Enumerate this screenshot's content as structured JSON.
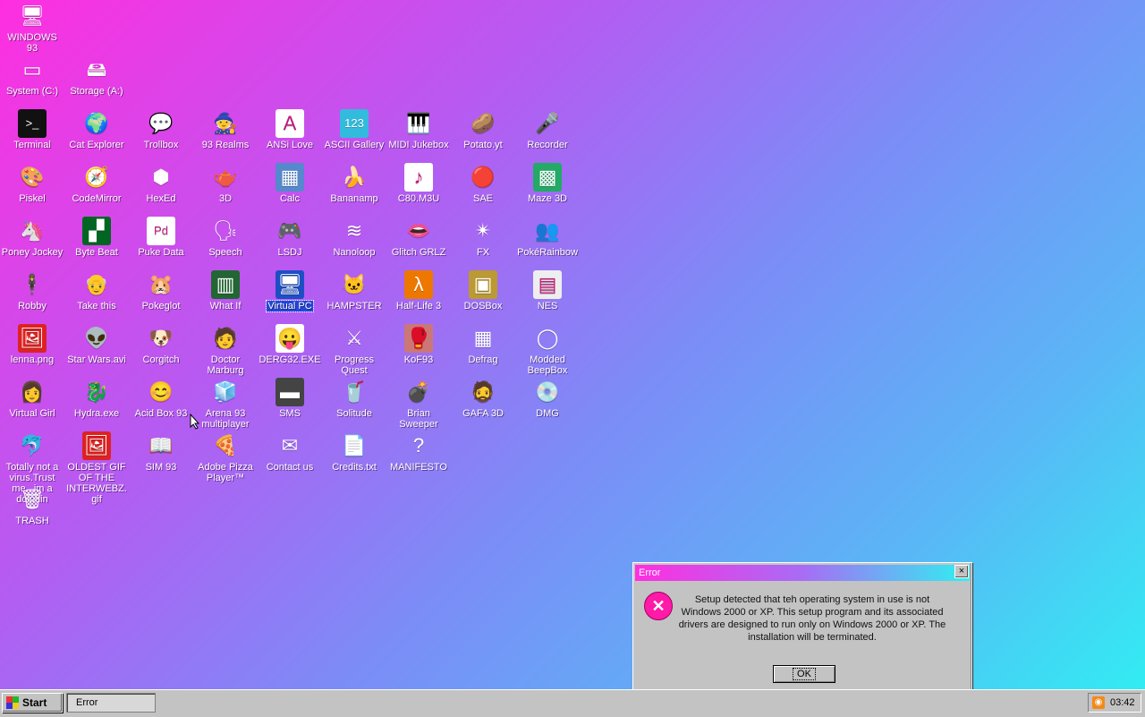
{
  "desktop": {
    "icons": [
      {
        "id": "windows93",
        "label": "WINDOWS 93",
        "glyph": "🖥",
        "bg": "transparent"
      },
      {
        "id": "system-c",
        "label": "System (C:)",
        "glyph": "▭",
        "bg": "transparent"
      },
      {
        "id": "storage-a",
        "label": "Storage (A:)",
        "glyph": "🖴",
        "bg": "transparent"
      },
      {
        "id": "terminal",
        "label": "Terminal",
        "glyph": ">_",
        "bg": "#111"
      },
      {
        "id": "cat-explorer",
        "label": "Cat Explorer",
        "glyph": "🌍",
        "bg": "transparent"
      },
      {
        "id": "trollbox",
        "label": "Trollbox",
        "glyph": "💬",
        "bg": "transparent"
      },
      {
        "id": "93-realms",
        "label": "93 Realms",
        "glyph": "🧙",
        "bg": "transparent"
      },
      {
        "id": "ansi-love",
        "label": "ANSi Love",
        "glyph": "A",
        "bg": "#fff"
      },
      {
        "id": "ascii-gallery",
        "label": "ASCII Gallery",
        "glyph": "123",
        "bg": "#3bd"
      },
      {
        "id": "midi-jukebox",
        "label": "MIDI Jukebox",
        "glyph": "🎹",
        "bg": "transparent"
      },
      {
        "id": "potato-yt",
        "label": "Potato.yt",
        "glyph": "🥔",
        "bg": "transparent"
      },
      {
        "id": "recorder",
        "label": "Recorder",
        "glyph": "🎤",
        "bg": "transparent"
      },
      {
        "id": "piskel",
        "label": "Piskel",
        "glyph": "🎨",
        "bg": "transparent"
      },
      {
        "id": "codemirror",
        "label": "CodeMirror",
        "glyph": "🧭",
        "bg": "transparent"
      },
      {
        "id": "hexed",
        "label": "HexEd",
        "glyph": "⬢",
        "bg": "transparent"
      },
      {
        "id": "3d",
        "label": "3D",
        "glyph": "🫖",
        "bg": "transparent"
      },
      {
        "id": "calc",
        "label": "Calc",
        "glyph": "▦",
        "bg": "#58c"
      },
      {
        "id": "bananamp",
        "label": "Bananamp",
        "glyph": "🍌",
        "bg": "transparent"
      },
      {
        "id": "c80-m3u",
        "label": "C80.M3U",
        "glyph": "♪",
        "bg": "#fff"
      },
      {
        "id": "sae",
        "label": "SAE",
        "glyph": "🔴",
        "bg": "transparent"
      },
      {
        "id": "maze-3d",
        "label": "Maze 3D",
        "glyph": "▩",
        "bg": "#2a6"
      },
      {
        "id": "poney-jockey",
        "label": "Poney Jockey",
        "glyph": "🦄",
        "bg": "transparent"
      },
      {
        "id": "byte-beat",
        "label": "Byte Beat",
        "glyph": "▞",
        "bg": "#062"
      },
      {
        "id": "puke-data",
        "label": "Puke Data",
        "glyph": "Pd",
        "bg": "#fff"
      },
      {
        "id": "speech",
        "label": "Speech",
        "glyph": "🗣",
        "bg": "transparent"
      },
      {
        "id": "lsdj",
        "label": "LSDJ",
        "glyph": "🎮",
        "bg": "transparent"
      },
      {
        "id": "nanoloop",
        "label": "Nanoloop",
        "glyph": "≋",
        "bg": "transparent"
      },
      {
        "id": "glitch-grlz",
        "label": "Glitch GRLZ",
        "glyph": "👄",
        "bg": "transparent"
      },
      {
        "id": "fx",
        "label": "FX",
        "glyph": "✴",
        "bg": "transparent"
      },
      {
        "id": "pokerainbow",
        "label": "PokéRainbow",
        "glyph": "👥",
        "bg": "transparent"
      },
      {
        "id": "robby",
        "label": "Robby",
        "glyph": "🕴",
        "bg": "transparent"
      },
      {
        "id": "take-this",
        "label": "Take this",
        "glyph": "👴",
        "bg": "transparent"
      },
      {
        "id": "pokeglot",
        "label": "Pokeglot",
        "glyph": "🐹",
        "bg": "transparent"
      },
      {
        "id": "what-if",
        "label": "What If",
        "glyph": "▥",
        "bg": "#263"
      },
      {
        "id": "virtual-pc",
        "label": "Virtual PC",
        "glyph": "🖥",
        "bg": "#1d4fc4"
      },
      {
        "id": "hampster",
        "label": "HAMPSTER",
        "glyph": "🐱",
        "bg": "transparent"
      },
      {
        "id": "half-life-3",
        "label": "Half-Life 3",
        "glyph": "λ",
        "bg": "#e70"
      },
      {
        "id": "dosbox",
        "label": "DOSBox",
        "glyph": "▣",
        "bg": "#b93"
      },
      {
        "id": "nes",
        "label": "NES",
        "glyph": "▤",
        "bg": "#eee"
      },
      {
        "id": "lenna-png",
        "label": "lenna.png",
        "glyph": "🖼",
        "bg": "#d22"
      },
      {
        "id": "star-wars",
        "label": "Star Wars.avi",
        "glyph": "👽",
        "bg": "transparent"
      },
      {
        "id": "corgitch",
        "label": "Corgitch",
        "glyph": "🐶",
        "bg": "transparent"
      },
      {
        "id": "doctor-marburg",
        "label": "Doctor Marburg",
        "glyph": "🧑",
        "bg": "transparent"
      },
      {
        "id": "derg32",
        "label": "DERG32.EXE",
        "glyph": "😛",
        "bg": "#fff"
      },
      {
        "id": "progress-quest",
        "label": "Progress Quest",
        "glyph": "⚔",
        "bg": "transparent"
      },
      {
        "id": "kof93",
        "label": "KoF93",
        "glyph": "🥊",
        "bg": "#c77"
      },
      {
        "id": "defrag",
        "label": "Defrag",
        "glyph": "▦",
        "bg": "transparent"
      },
      {
        "id": "modded-beepbox",
        "label": "Modded BeepBox",
        "glyph": "◯",
        "bg": "transparent"
      },
      {
        "id": "virtual-girl",
        "label": "Virtual Girl",
        "glyph": "👩",
        "bg": "transparent"
      },
      {
        "id": "hydra-exe",
        "label": "Hydra.exe",
        "glyph": "🐉",
        "bg": "transparent"
      },
      {
        "id": "acid-box-93",
        "label": "Acid Box 93",
        "glyph": "😊",
        "bg": "transparent"
      },
      {
        "id": "arena-93",
        "label": "Arena 93 multiplayer",
        "glyph": "🧊",
        "bg": "transparent"
      },
      {
        "id": "sms",
        "label": "SMS",
        "glyph": "▬",
        "bg": "#444"
      },
      {
        "id": "solitude",
        "label": "Solitude",
        "glyph": "🥤",
        "bg": "transparent"
      },
      {
        "id": "brian-sweeper",
        "label": "Brian Sweeper",
        "glyph": "💣",
        "bg": "transparent"
      },
      {
        "id": "gafa-3d",
        "label": "GAFA 3D",
        "glyph": "🧔",
        "bg": "transparent"
      },
      {
        "id": "dmg",
        "label": "DMG",
        "glyph": "💿",
        "bg": "transparent"
      },
      {
        "id": "totally-not-a-virus",
        "label": "Totally not a virus.Trust me...im a dolphin",
        "glyph": "🐬",
        "bg": "transparent"
      },
      {
        "id": "oldest-gif",
        "label": "OLDEST GIF OF THE INTERWEBZ.gif",
        "glyph": "🖼",
        "bg": "#d22"
      },
      {
        "id": "sim-93",
        "label": "SIM 93",
        "glyph": "📖",
        "bg": "transparent"
      },
      {
        "id": "adobe-pizza",
        "label": "Adobe Pizza Player™",
        "glyph": "🍕",
        "bg": "transparent"
      },
      {
        "id": "contact-us",
        "label": "Contact us",
        "glyph": "✉",
        "bg": "transparent"
      },
      {
        "id": "credits-txt",
        "label": "Credits.txt",
        "glyph": "📄",
        "bg": "transparent"
      },
      {
        "id": "manifesto",
        "label": "MANIFESTO",
        "glyph": "?",
        "bg": "transparent"
      },
      {
        "id": "trash",
        "label": "TRASH",
        "glyph": "🗑",
        "bg": "transparent"
      }
    ],
    "selected": "virtual-pc"
  },
  "dialog": {
    "title": "Error",
    "close_label": "×",
    "message": "Setup detected that teh operating system in use is not Windows 2000 or XP. This setup program and its associated drivers are designed to run only on Windows 2000 or XP. The installation will be terminated.",
    "ok_label": "OK",
    "icon_glyph": "✕"
  },
  "taskbar": {
    "start_label": "Start",
    "tasks": [
      "Error"
    ],
    "clock": "03:42",
    "tray_icon": "rss-icon"
  }
}
